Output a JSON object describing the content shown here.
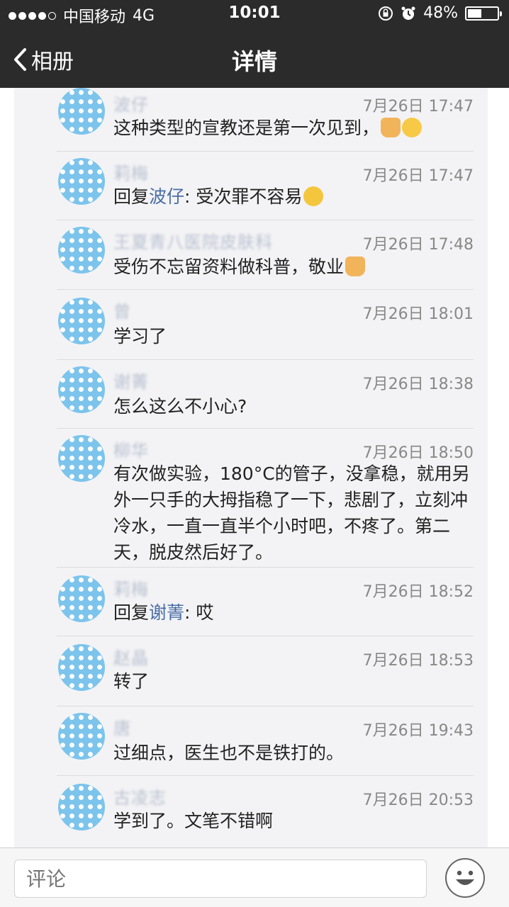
{
  "status_bar": {
    "carrier": "中国移动",
    "network": "4G",
    "time": "10:01",
    "battery_text": "48%",
    "battery_level": 0.48,
    "signal_icon": "signal-dots-icon"
  },
  "nav": {
    "back_label": "相册",
    "title": "详情"
  },
  "comments": [
    {
      "name": "波仔",
      "time": "7月26日 17:47",
      "text": "这种类型的宣教还是第一次见到，",
      "emojis": [
        "thumb",
        "grin"
      ]
    },
    {
      "name": "莉梅",
      "time": "7月26日 17:47",
      "reply_prefix": "回复",
      "reply_to": "波仔",
      "text": ": 受次罪不容易",
      "emojis": [
        "cry"
      ]
    },
    {
      "name": "王夏青八医院皮肤科",
      "time": "7月26日 17:48",
      "text": "受伤不忘留资料做科普，敬业",
      "emojis": [
        "thumb"
      ]
    },
    {
      "name": "曾",
      "time": "7月26日 18:01",
      "text": "学习了"
    },
    {
      "name": "谢菁",
      "time": "7月26日 18:38",
      "text": "怎么这么不小心?"
    },
    {
      "name": "柳华",
      "time": "7月26日 18:50",
      "text": "有次做实验，180°C的管子，没拿稳，就用另外一只手的大拇指稳了一下，悲剧了，立刻冲冷水，一直一直半个小时吧，不疼了。第二天，脱皮然后好了。"
    },
    {
      "name": "莉梅",
      "time": "7月26日 18:52",
      "reply_prefix": "回复",
      "reply_to": "谢菁",
      "text": ": 哎"
    },
    {
      "name": "赵晶",
      "time": "7月26日 18:53",
      "text": "转了"
    },
    {
      "name": "唐",
      "time": "7月26日 19:43",
      "text": "过细点，医生也不是铁打的。"
    },
    {
      "name": "古凌志",
      "time": "7月26日 20:53",
      "text": "学到了。文笔不错啊"
    }
  ],
  "input": {
    "placeholder": "评论",
    "emoji_button_icon": "smiley-icon"
  }
}
